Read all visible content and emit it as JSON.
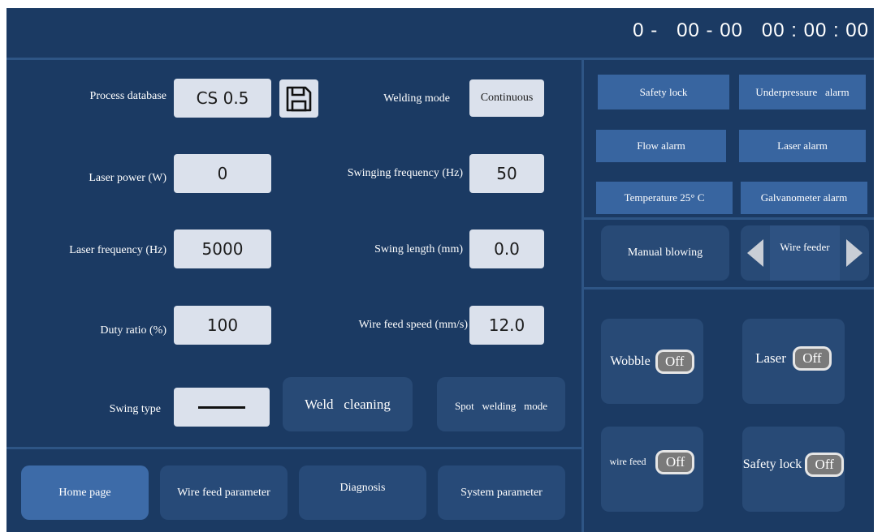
{
  "header": {
    "datetime": "0 -   00 - 00   00 : 00 : 00"
  },
  "params": {
    "process_database": {
      "label": "Process database",
      "value": "CS 0.5"
    },
    "welding_mode": {
      "label": "Welding mode",
      "value": "Continuous"
    },
    "laser_power": {
      "label": "Laser power (W)",
      "value": "0"
    },
    "swinging_frequency": {
      "label": "Swinging frequency (Hz)",
      "value": "50"
    },
    "laser_frequency": {
      "label": "Laser frequency (Hz)",
      "value": "5000"
    },
    "swing_length": {
      "label": "Swing length (mm)",
      "value": "0.0"
    },
    "duty_ratio": {
      "label": "Duty ratio (%)",
      "value": "100"
    },
    "wire_feed_speed": {
      "label": "Wire feed speed (mm/s)",
      "value": "12.0"
    },
    "swing_type": {
      "label": "Swing type"
    }
  },
  "actions": {
    "weld_cleaning": "Weld   cleaning",
    "spot_welding_mode": "Spot   welding   mode"
  },
  "nav": {
    "tabs": [
      "Home page",
      "Wire feed parameter",
      "Diagnosis",
      "System parameter"
    ]
  },
  "alarms": [
    "Safety lock",
    "Underpressure   alarm",
    "Flow alarm",
    "Laser alarm",
    "Temperature 25° C",
    "Galvanometer alarm"
  ],
  "controls": {
    "manual_blowing": "Manual blowing",
    "wire_feeder": "Wire feeder"
  },
  "toggles": [
    {
      "label": "Wobble",
      "state": "Off"
    },
    {
      "label": "Laser",
      "state": "Off"
    },
    {
      "label": "wire feed",
      "state": "Off"
    },
    {
      "label": "Safety lock",
      "state": "Off"
    }
  ],
  "colors": {
    "background": "#1b3a63",
    "panel": "#284a76",
    "alarm": "#3865a0",
    "field": "#dbe1ec",
    "active_tab": "#3d6ba8"
  }
}
